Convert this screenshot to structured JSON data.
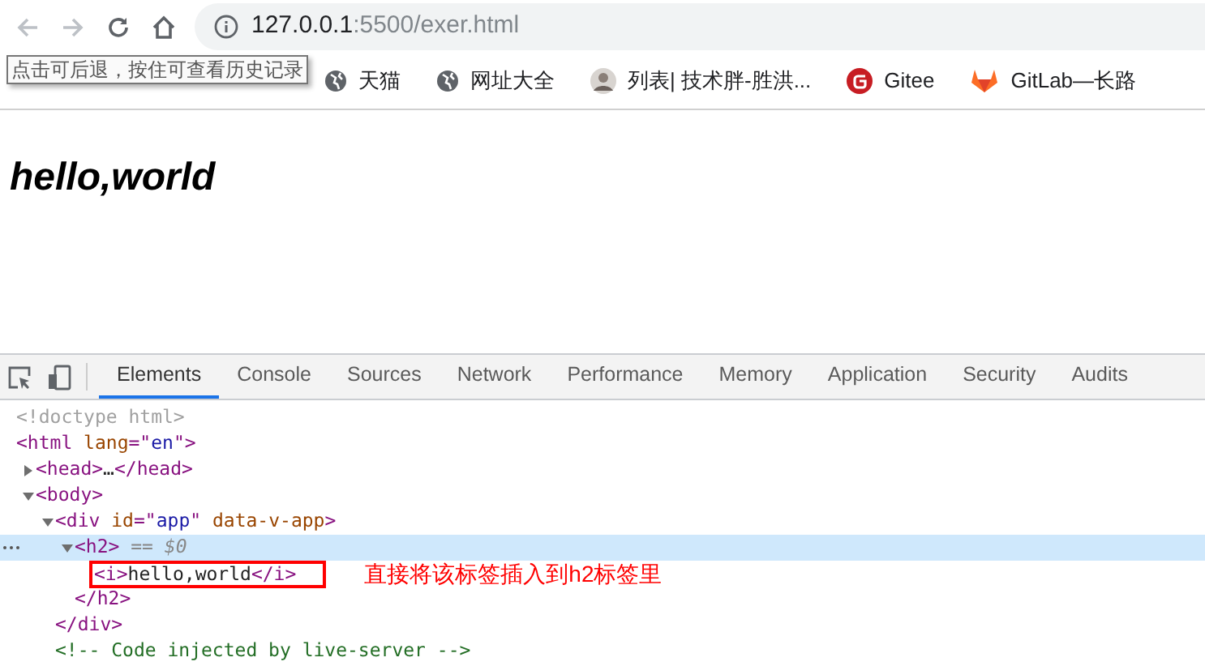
{
  "toolbar": {
    "back": {
      "disabled": true
    },
    "forward": {
      "disabled": true
    },
    "address": {
      "host": "127.0.0.1",
      "rest": ":5500/exer.html"
    }
  },
  "tooltip": "点击可后退，按住可查看历史记录",
  "bookmarks": [
    {
      "label": "天猫",
      "kind": "globe"
    },
    {
      "label": "网址大全",
      "kind": "globe"
    },
    {
      "label": "列表| 技术胖-胜洪...",
      "kind": "avatar"
    },
    {
      "label": "Gitee",
      "kind": "gitee"
    },
    {
      "label": "GitLab—长路",
      "kind": "gitlab"
    }
  ],
  "page": {
    "heading": "hello,world"
  },
  "devtools": {
    "tabs": [
      {
        "label": "Elements",
        "selected": true
      },
      {
        "label": "Console",
        "selected": false
      },
      {
        "label": "Sources",
        "selected": false
      },
      {
        "label": "Network",
        "selected": false
      },
      {
        "label": "Performance",
        "selected": false
      },
      {
        "label": "Memory",
        "selected": false
      },
      {
        "label": "Application",
        "selected": false
      },
      {
        "label": "Security",
        "selected": false
      },
      {
        "label": "Audits",
        "selected": false
      }
    ],
    "tree": [
      {
        "tokens": [
          {
            "kind": "doctype",
            "text": "<!doctype html>"
          }
        ]
      },
      {
        "tokens": [
          {
            "kind": "tag",
            "text": "<html"
          },
          {
            "kind": "attr",
            "text": " lang"
          },
          {
            "kind": "tag",
            "text": "=\""
          },
          {
            "kind": "value",
            "text": "en"
          },
          {
            "kind": "tag",
            "text": "\">"
          }
        ],
        "children": [
          {
            "expanded": false,
            "tokens": [
              {
                "kind": "tag",
                "text": "<head>"
              },
              {
                "kind": "text",
                "text": "…"
              },
              {
                "kind": "tag",
                "text": "</head>"
              }
            ]
          },
          {
            "expanded": true,
            "tokens": [
              {
                "kind": "tag",
                "text": "<body>"
              }
            ],
            "children": [
              {
                "expanded": true,
                "tokens": [
                  {
                    "kind": "tag",
                    "text": "<div"
                  },
                  {
                    "kind": "attr",
                    "text": " id"
                  },
                  {
                    "kind": "tag",
                    "text": "=\""
                  },
                  {
                    "kind": "value",
                    "text": "app"
                  },
                  {
                    "kind": "tag",
                    "text": "\""
                  },
                  {
                    "kind": "attr",
                    "text": " data-v-app"
                  },
                  {
                    "kind": "tag",
                    "text": ">"
                  }
                ],
                "closing": "</div>",
                "children": [
                  {
                    "expanded": true,
                    "selected": true,
                    "tokens": [
                      {
                        "kind": "tag",
                        "text": "<h2>"
                      },
                      {
                        "kind": "marker",
                        "text": " == $0"
                      }
                    ],
                    "closing": "</h2>",
                    "children": [
                      {
                        "boxed": true,
                        "annotation": "直接将该标签插入到h2标签里",
                        "tokens": [
                          {
                            "kind": "tag",
                            "text": "<i>"
                          },
                          {
                            "kind": "text",
                            "text": "hello,world"
                          },
                          {
                            "kind": "tag",
                            "text": "</i>"
                          }
                        ]
                      }
                    ]
                  }
                ]
              },
              {
                "tokens": [
                  {
                    "kind": "comment",
                    "text": "<!-- Code injected by live-server -->"
                  }
                ]
              }
            ]
          }
        ]
      }
    ]
  }
}
